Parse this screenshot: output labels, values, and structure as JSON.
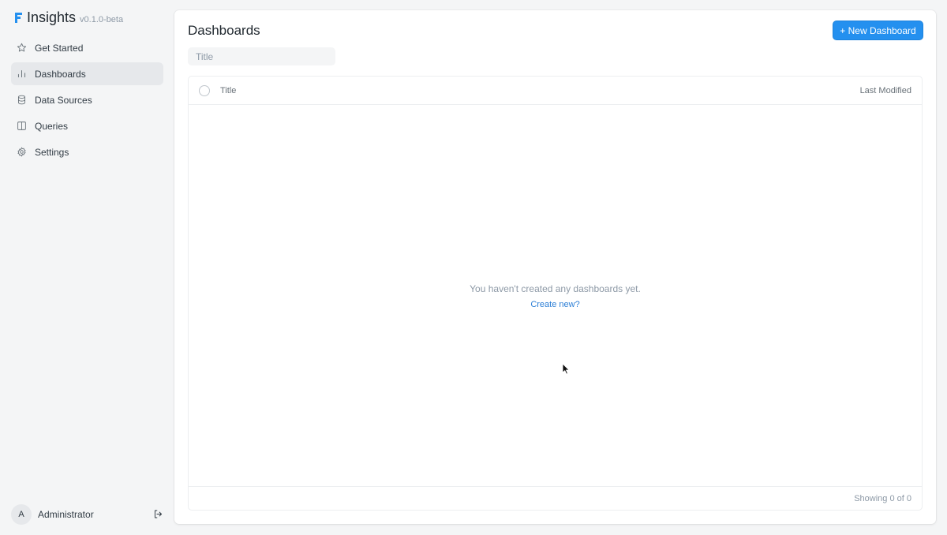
{
  "brand": {
    "name": "Insights",
    "version": "v0.1.0-beta",
    "accent": "#2490ef"
  },
  "sidebar": {
    "items": [
      {
        "label": "Get Started",
        "icon": "star-icon",
        "active": false
      },
      {
        "label": "Dashboards",
        "icon": "bar-chart-icon",
        "active": true
      },
      {
        "label": "Data Sources",
        "icon": "database-icon",
        "active": false
      },
      {
        "label": "Queries",
        "icon": "columns-icon",
        "active": false
      },
      {
        "label": "Settings",
        "icon": "gear-icon",
        "active": false
      }
    ]
  },
  "user": {
    "initial": "A",
    "name": "Administrator",
    "logout_icon": "logout-icon"
  },
  "main": {
    "title": "Dashboards",
    "new_button_label": "+ New Dashboard",
    "filter_placeholder": "Title",
    "table": {
      "columns": [
        "Title",
        "Last Modified"
      ],
      "empty_message": "You haven't created any dashboards yet.",
      "empty_link": "Create new?",
      "footer": "Showing 0 of 0"
    }
  }
}
